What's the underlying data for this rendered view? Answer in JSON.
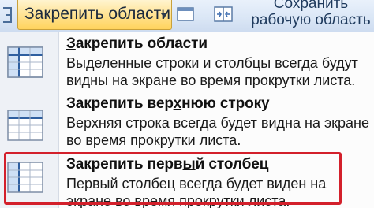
{
  "ribbon": {
    "freeze_button_label": "Закрепить области",
    "save_workspace_label_line1": "Сохранить",
    "save_workspace_label_line2": "рабочую область"
  },
  "menu": {
    "items": [
      {
        "title_pre": "",
        "title_ul": "З",
        "title_post": "акрепить области",
        "description": "Выделенные строки и столбцы всегда будут видны на экране во время прокрутки листа.",
        "icon": "freeze-panes-icon"
      },
      {
        "title_pre": "Закрепить вер",
        "title_ul": "х",
        "title_post": "нюю строку",
        "description": "Верхняя строка всегда будет видна на экране во время прокрутки листа.",
        "icon": "freeze-top-row-icon"
      },
      {
        "title_pre": "Закрепить перв",
        "title_ul": "ы",
        "title_post": "й столбец",
        "description": "Первый столбец всегда будет виден на экране во время прокрутки листа.",
        "icon": "freeze-first-column-icon"
      }
    ]
  },
  "colors": {
    "highlight_border": "#d3202b",
    "ribbon_active": "#ffd35c",
    "ribbon_bg": "#dbe7f6"
  }
}
